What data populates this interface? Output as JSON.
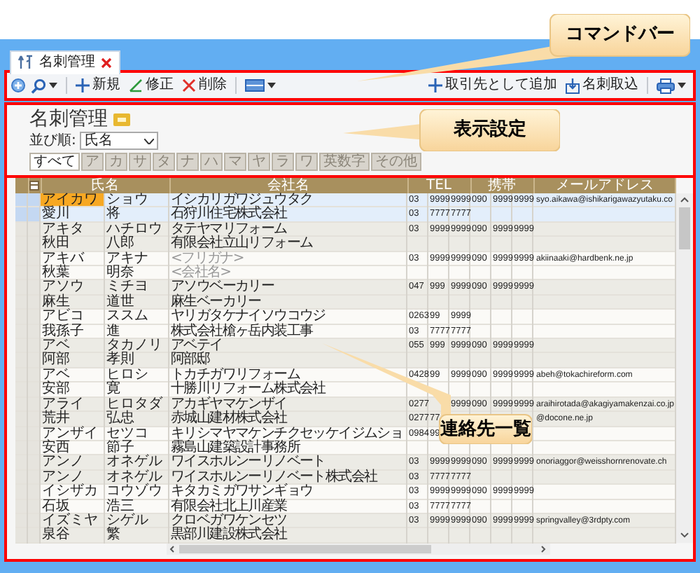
{
  "tab": {
    "title": "名刺管理"
  },
  "command_bar": {
    "left": [
      {
        "kind": "expand"
      },
      {
        "kind": "search",
        "dropdown": true
      },
      {
        "kind": "new",
        "label": "新規"
      },
      {
        "kind": "edit",
        "label": "修正"
      },
      {
        "kind": "delete",
        "label": "削除"
      },
      {
        "kind": "view",
        "dropdown": true
      }
    ],
    "right": [
      {
        "kind": "add",
        "label": "取引先として追加"
      },
      {
        "kind": "import",
        "label": "名刺取込"
      },
      {
        "kind": "print",
        "dropdown": true
      }
    ]
  },
  "page_title": "名刺管理",
  "sort": {
    "label": "並び順:",
    "value": "氏名"
  },
  "index_tabs": [
    {
      "label": "すべて",
      "selected": true
    },
    {
      "label": "ア",
      "selected": false
    },
    {
      "label": "カ",
      "selected": false
    },
    {
      "label": "サ",
      "selected": false
    },
    {
      "label": "タ",
      "selected": false
    },
    {
      "label": "ナ",
      "selected": false
    },
    {
      "label": "ハ",
      "selected": false
    },
    {
      "label": "マ",
      "selected": false
    },
    {
      "label": "ヤ",
      "selected": false
    },
    {
      "label": "ラ",
      "selected": false
    },
    {
      "label": "ワ",
      "selected": false
    },
    {
      "label": "英数字",
      "selected": false
    },
    {
      "label": "その他",
      "selected": false
    }
  ],
  "table": {
    "columns": [
      "氏名",
      "会社名",
      "TEL",
      "携帯",
      "メールアドレス"
    ],
    "rows": [
      {
        "selected": true,
        "focused": true,
        "name": [
          "アイカワ",
          "ショウ"
        ],
        "company": "イシカリガワジュウタク",
        "tel": {
          "part_1": "03",
          "part_2": "9999",
          "part_3": "9999"
        },
        "mobile": {
          "part_1": "090",
          "part_2": "9999",
          "part_3": "9999"
        },
        "email": "syo.aikawa@ishikarigawazyutaku.co"
      },
      {
        "selected": true,
        "focused": false,
        "name": [
          "愛川",
          "将"
        ],
        "company": "石狩川住宅株式会社",
        "tel": {
          "part_1": "03",
          "part_2": "7777",
          "part_3": "7777"
        }
      },
      {
        "selected": false,
        "focused": false,
        "name": [
          "アキタ",
          "ハチロウ"
        ],
        "company": "タテヤマリフォーム",
        "tel": {
          "part_1": "03",
          "part_2": "9999",
          "part_3": "9999"
        },
        "mobile": {
          "part_1": "090",
          "part_2": "9999",
          "part_3": "9999"
        }
      },
      {
        "selected": false,
        "focused": false,
        "name": [
          "秋田",
          "八郎"
        ],
        "company": "有限会社立山リフォーム"
      },
      {
        "selected": false,
        "focused": false,
        "name": [
          "アキバ",
          "アキナ"
        ],
        "company": {
          "placeholder": "<フリガナ>"
        },
        "tel": {
          "part_1": "03",
          "part_2": "9999",
          "part_3": "9999"
        },
        "mobile": {
          "part_1": "090",
          "part_2": "9999",
          "part_3": "9999"
        },
        "email": "akiinaaki@hardbenk.ne.jp"
      },
      {
        "selected": false,
        "focused": false,
        "name": [
          "秋葉",
          "明奈"
        ],
        "company": {
          "placeholder": "<会社名>"
        }
      },
      {
        "selected": false,
        "focused": false,
        "name": [
          "アソウ",
          "ミチヨ"
        ],
        "company": "アソウベーカリー",
        "tel": {
          "part_1": "047",
          "part_2": "999",
          "part_3": "9999"
        },
        "mobile": {
          "part_1": "090",
          "part_2": "9999",
          "part_3": "9999"
        }
      },
      {
        "selected": false,
        "focused": false,
        "name": [
          "麻生",
          "道世"
        ],
        "company": "麻生ベーカリー"
      },
      {
        "selected": false,
        "focused": false,
        "name": [
          "アビコ",
          "ススム"
        ],
        "company": "ヤリガタケナイソウコウジ",
        "tel": {
          "part_1": "0263",
          "part_2": "99",
          "part_3": "9999"
        }
      },
      {
        "selected": false,
        "focused": false,
        "name": [
          "我孫子",
          "進"
        ],
        "company": "株式会社槍ヶ岳内装工事",
        "tel": {
          "part_1": "03",
          "part_2": "7777",
          "part_3": "7777"
        }
      },
      {
        "selected": false,
        "focused": false,
        "name": [
          "アベ",
          "タカノリ"
        ],
        "company": "アベテイ",
        "tel": {
          "part_1": "055",
          "part_2": "999",
          "part_3": "9999"
        },
        "mobile": {
          "part_1": "090",
          "part_2": "9999",
          "part_3": "9999"
        }
      },
      {
        "selected": false,
        "focused": false,
        "name": [
          "阿部",
          "孝則"
        ],
        "company": "阿部邸"
      },
      {
        "selected": false,
        "focused": false,
        "name": [
          "アベ",
          "ヒロシ"
        ],
        "company": "トカチガワリフォーム",
        "tel": {
          "part_1": "0428",
          "part_2": "99",
          "part_3": "9999"
        },
        "mobile": {
          "part_1": "090",
          "part_2": "9999",
          "part_3": "9999"
        },
        "email": "abeh@tokachireform.com"
      },
      {
        "selected": false,
        "focused": false,
        "name": [
          "安部",
          "寛"
        ],
        "company": "十勝川リフォーム株式会社"
      },
      {
        "selected": false,
        "focused": false,
        "name": [
          "アライ",
          "ヒロタダ"
        ],
        "company": "アカギヤマケンザイ",
        "tel": {
          "part_1": "0277",
          "part_3": "9999"
        },
        "mobile": {
          "part_1": "090",
          "part_2": "9999",
          "part_3": "9999"
        },
        "email": "araihirotada@akagiyamakenzai.co.jp"
      },
      {
        "selected": false,
        "focused": false,
        "name": [
          "荒井",
          "弘忠"
        ],
        "company": "赤城山建材株式会社",
        "tel": {
          "part_1": "0277",
          "part_2": "77"
        },
        "email": "@docone.ne.jp"
      },
      {
        "selected": false,
        "focused": false,
        "name": [
          "アンザイ",
          "セツコ"
        ],
        "company": "キリシマヤマケンチクセッケイジムショ",
        "tel": {
          "part_1": "0984",
          "part_2": "99"
        }
      },
      {
        "selected": false,
        "focused": false,
        "name": [
          "安西",
          "節子"
        ],
        "company": "霧島山建築設計事務所"
      },
      {
        "selected": false,
        "focused": false,
        "name": [
          "アンノ",
          "オネゲル"
        ],
        "company": "ワイスホルンーリノベート",
        "tel": {
          "part_1": "03",
          "part_2": "9999",
          "part_3": "9999"
        },
        "mobile": {
          "part_1": "090",
          "part_2": "9999",
          "part_3": "9999"
        },
        "email": "onoriaggor@weisshornrenovate.ch"
      },
      {
        "selected": false,
        "focused": false,
        "name": [
          "アンノ",
          "オネゲル"
        ],
        "company": "ワイスホルンーリノベート株式会社",
        "tel": {
          "part_1": "03",
          "part_2": "7777",
          "part_3": "7777"
        }
      },
      {
        "selected": false,
        "focused": false,
        "name": [
          "イシザカ",
          "コウゾウ"
        ],
        "company": "キタカミガワサンギョウ",
        "tel": {
          "part_1": "03",
          "part_2": "9999",
          "part_3": "9999"
        },
        "mobile": {
          "part_1": "090",
          "part_2": "9999",
          "part_3": "9999"
        }
      },
      {
        "selected": false,
        "focused": false,
        "name": [
          "石坂",
          "浩三"
        ],
        "company": "有限会社北上川産業",
        "tel": {
          "part_1": "03",
          "part_2": "7777",
          "part_3": "7777"
        }
      },
      {
        "selected": false,
        "focused": false,
        "name": [
          "イズミヤ",
          "シゲル"
        ],
        "company": "クロベガワケンセツ",
        "tel": {
          "part_1": "03",
          "part_2": "9999",
          "part_3": "9999"
        },
        "mobile": {
          "part_1": "090",
          "part_2": "9999",
          "part_3": "9999"
        },
        "email": "springvalley@3rdpty.com"
      },
      {
        "selected": false,
        "focused": false,
        "name": [
          "泉谷",
          "繁"
        ],
        "company": "黒部川建設株式会社"
      }
    ]
  },
  "callouts": [
    {
      "label": "コマンドバー"
    },
    {
      "label": "表示設定"
    },
    {
      "label": "連絡先一覧"
    }
  ]
}
